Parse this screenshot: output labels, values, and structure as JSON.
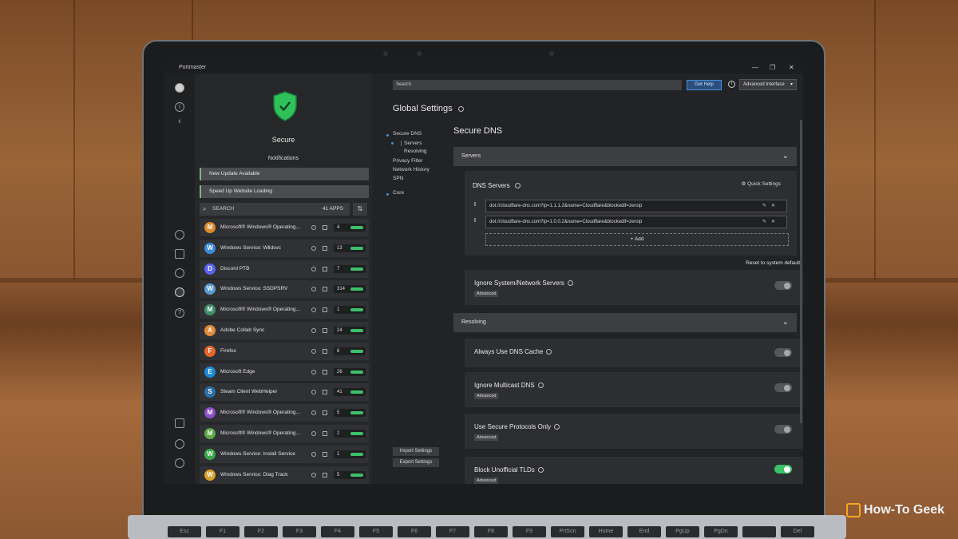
{
  "titlebar": {
    "app_name": "Portmaster"
  },
  "status": {
    "label": "Secure",
    "color": "#2fc25b"
  },
  "notifications": {
    "heading": "Notifications",
    "items": [
      "New Update Available",
      "Speed Up Website Loading"
    ]
  },
  "app_search": {
    "placeholder": "SEARCH",
    "count": "41 APPS"
  },
  "apps": [
    {
      "name": "Microsoft® Windows® Operating...",
      "count": "4",
      "icon": "M",
      "color": "#d98a2a"
    },
    {
      "name": "Windows Service: Wlidsvc",
      "count": "13",
      "icon": "W",
      "color": "#3a8ad8"
    },
    {
      "name": "Discord PTB",
      "count": "7",
      "icon": "D",
      "color": "#5865f2"
    },
    {
      "name": "Windows Service: SSDPSRV",
      "count": "314",
      "icon": "W",
      "color": "#5a9ad0"
    },
    {
      "name": "Microsoft® Windows® Operating...",
      "count": "1",
      "icon": "M",
      "color": "#3f8f6a"
    },
    {
      "name": "Adobe Collab Sync",
      "count": "24",
      "icon": "A",
      "color": "#e08a3a"
    },
    {
      "name": "Firefox",
      "count": "6",
      "icon": "F",
      "color": "#e5662b"
    },
    {
      "name": "Microsoft Edge",
      "count": "26",
      "icon": "E",
      "color": "#1e8ad6"
    },
    {
      "name": "Steam Client WebHelper",
      "count": "41",
      "icon": "S",
      "color": "#2a6fa8"
    },
    {
      "name": "Microsoft® Windows® Operating...",
      "count": "5",
      "icon": "M",
      "color": "#8a4fc4"
    },
    {
      "name": "Microsoft® Windows® Operating...",
      "count": "2",
      "icon": "M",
      "color": "#5aa84a"
    },
    {
      "name": "Windows Service: Install Service",
      "count": "1",
      "icon": "W",
      "color": "#3aa84a"
    },
    {
      "name": "Windows Service: Diag Track",
      "count": "5",
      "icon": "W",
      "color": "#d8a02a"
    }
  ],
  "nav": {
    "items": [
      "Secure DNS",
      "Servers",
      "Resolving",
      "Privacy Filter",
      "Network History",
      "SPN",
      "Core"
    ],
    "import_label": "Import Settings",
    "export_label": "Export Settings"
  },
  "header": {
    "search_placeholder": "Search",
    "get_help": "Get Help",
    "interface_mode": "Advanced Interface"
  },
  "main": {
    "global_title": "Global Settings",
    "section_title": "Secure DNS",
    "servers_bar": "Servers",
    "dns_servers_title": "DNS Servers",
    "quick_settings": "Quick Settings",
    "dns_entries": [
      "dot://cloudflare-dns.com?ip=1.1.1.2&name=Cloudflare&blockedif=zeroip",
      "dot://cloudflare-dns.com?ip=1.0.0.2&name=Cloudflare&blockedif=zeroip"
    ],
    "add_label": "+ Add",
    "reset_label": "Reset to system default",
    "resolving_bar": "Resolving",
    "advanced_badge": "Advanced",
    "options": [
      {
        "title": "Ignore System/Network Servers",
        "advanced": true,
        "enabled": false
      },
      {
        "title": "Always Use DNS Cache",
        "advanced": false,
        "enabled": false
      },
      {
        "title": "Ignore Multicast DNS",
        "advanced": true,
        "enabled": false
      },
      {
        "title": "Use Secure Protocols Only",
        "advanced": true,
        "enabled": false
      },
      {
        "title": "Block Unofficial TLDs",
        "advanced": true,
        "enabled": true
      }
    ]
  },
  "keyboard": [
    "Esc",
    "F1",
    "F2",
    "F3",
    "F4",
    "F5",
    "F6",
    "F7",
    "F8",
    "F9",
    "PrtScn",
    "Home",
    "End",
    "PgUp",
    "PgDn",
    "",
    "Del"
  ],
  "watermark": {
    "text": "How-To Geek",
    "accent": "#f5a623"
  }
}
